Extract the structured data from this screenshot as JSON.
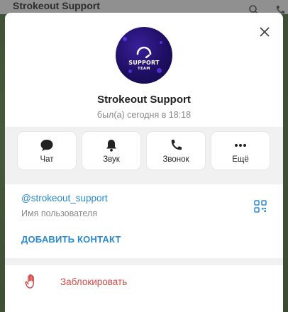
{
  "background": {
    "window_title": "Strokeout Support"
  },
  "profile": {
    "name": "Strokeout Support",
    "status": "был(а) сегодня в 18:18",
    "avatar_text_line1": "SUPPORT",
    "avatar_text_line2": "TEAM"
  },
  "actions": [
    {
      "label": "Чат",
      "icon": "chat-icon"
    },
    {
      "label": "Звук",
      "icon": "bell-icon"
    },
    {
      "label": "Звонок",
      "icon": "phone-icon"
    },
    {
      "label": "Ещё",
      "icon": "more-icon"
    }
  ],
  "info": {
    "username": "@strokeout_support",
    "username_caption": "Имя пользователя",
    "add_contact": "ДОБАВИТЬ КОНТАКТ"
  },
  "block": {
    "label": "Заблокировать"
  },
  "colors": {
    "accent": "#2a8ad0",
    "danger": "#d14a4a",
    "avatar": "#1e0f63"
  }
}
